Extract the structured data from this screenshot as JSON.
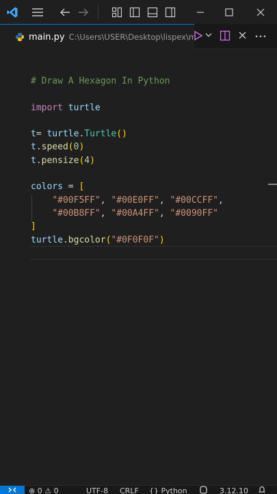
{
  "titlebar": {
    "icons": [
      "vscode-logo-icon",
      "menu-icon",
      "back-arrow-icon",
      "forward-arrow-icon",
      "customize-layout-icon",
      "toggle-primary-sidebar-icon",
      "toggle-panel-icon",
      "toggle-secondary-sidebar-icon",
      "minimize-icon",
      "maximize-icon",
      "close-icon"
    ]
  },
  "tab": {
    "file_name": "main.py",
    "path": "C:\\Users\\USER\\Desktop\\lispex\\main.py",
    "actions": [
      "run-python-file-icon",
      "run-dropdown-chevron-icon",
      "split-editor-icon",
      "close-editor-icon",
      "more-actions-icon"
    ]
  },
  "editor": {
    "lines": [
      {
        "tokens": [
          {
            "t": "# Draw A Hexagon In Python",
            "c": "c-comment"
          }
        ]
      },
      {
        "tokens": []
      },
      {
        "tokens": [
          {
            "t": "import",
            "c": "c-kw"
          },
          {
            "t": " turtle",
            "c": "c-text"
          }
        ]
      },
      {
        "tokens": []
      },
      {
        "tokens": [
          {
            "t": "t",
            "c": "c-text"
          },
          {
            "t": "= ",
            "c": "c-plain"
          },
          {
            "t": "turtle",
            "c": "c-text"
          },
          {
            "t": ".",
            "c": "c-plain"
          },
          {
            "t": "Turtle",
            "c": "c-mod"
          },
          {
            "t": "()",
            "c": "c-br1"
          }
        ]
      },
      {
        "tokens": [
          {
            "t": "t",
            "c": "c-text"
          },
          {
            "t": ".",
            "c": "c-plain"
          },
          {
            "t": "speed",
            "c": "c-fn"
          },
          {
            "t": "(",
            "c": "c-br1"
          },
          {
            "t": "0",
            "c": "c-num"
          },
          {
            "t": ")",
            "c": "c-br1"
          }
        ]
      },
      {
        "tokens": [
          {
            "t": "t",
            "c": "c-text"
          },
          {
            "t": ".",
            "c": "c-plain"
          },
          {
            "t": "pensize",
            "c": "c-fn"
          },
          {
            "t": "(",
            "c": "c-br1"
          },
          {
            "t": "4",
            "c": "c-num"
          },
          {
            "t": ")",
            "c": "c-br1"
          }
        ]
      },
      {
        "tokens": []
      },
      {
        "tokens": [
          {
            "t": "colors",
            "c": "c-text"
          },
          {
            "t": " = ",
            "c": "c-plain"
          },
          {
            "t": "[",
            "c": "c-br1"
          }
        ]
      },
      {
        "tokens": [
          {
            "t": "    ",
            "c": "c-plain"
          },
          {
            "t": "\"#00F5FF\"",
            "c": "c-str"
          },
          {
            "t": ", ",
            "c": "c-plain"
          },
          {
            "t": "\"#00E0FF\"",
            "c": "c-str"
          },
          {
            "t": ", ",
            "c": "c-plain"
          },
          {
            "t": "\"#00CCFF\"",
            "c": "c-str"
          },
          {
            "t": ",",
            "c": "c-plain"
          }
        ]
      },
      {
        "tokens": [
          {
            "t": "    ",
            "c": "c-plain"
          },
          {
            "t": "\"#00B8FF\"",
            "c": "c-str"
          },
          {
            "t": ", ",
            "c": "c-plain"
          },
          {
            "t": "\"#00A4FF\"",
            "c": "c-str"
          },
          {
            "t": ", ",
            "c": "c-plain"
          },
          {
            "t": "\"#0090FF\"",
            "c": "c-str"
          }
        ]
      },
      {
        "tokens": [
          {
            "t": "]",
            "c": "c-br1"
          }
        ]
      },
      {
        "tokens": [
          {
            "t": "turtle",
            "c": "c-text"
          },
          {
            "t": ".",
            "c": "c-plain"
          },
          {
            "t": "bgcolor",
            "c": "c-fn"
          },
          {
            "t": "(",
            "c": "c-br1"
          },
          {
            "t": "\"#0F0F0F\"",
            "c": "c-str"
          },
          {
            "t": ")",
            "c": "c-br1"
          }
        ]
      },
      {
        "tokens": []
      }
    ]
  },
  "statusbar": {
    "errors": "0",
    "warnings": "0",
    "encoding": "UTF-8",
    "eol": "CRLF",
    "language": "Python",
    "python_version": "3.12.10",
    "icons": [
      "remote-icon",
      "error-icon",
      "warning-icon",
      "language-braces-icon",
      "copilot-icon",
      "bell-icon"
    ]
  },
  "colors": {
    "accent": "#0078d4",
    "background": "#1f1f1f",
    "python_icon": "#3572a5"
  }
}
